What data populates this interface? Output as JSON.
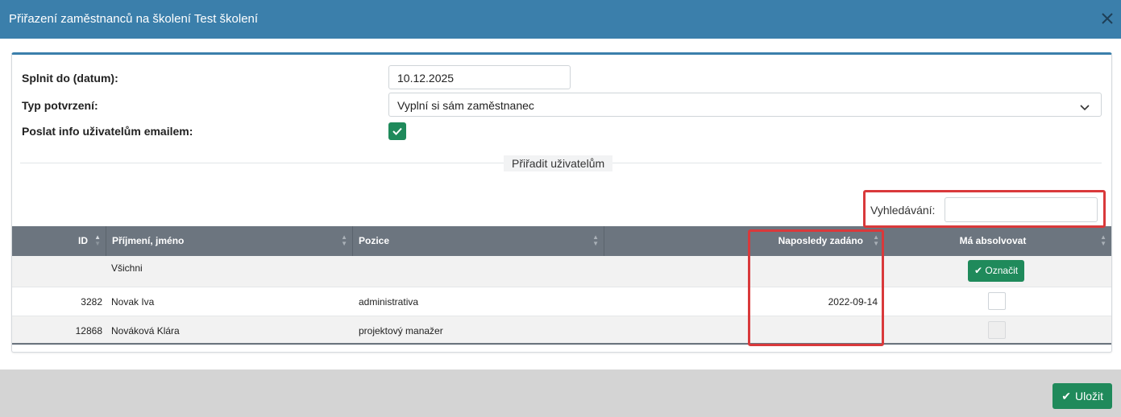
{
  "dialog": {
    "title": "Přiřazení zaměstnanců na školení Test školení"
  },
  "form": {
    "deadline_label": "Splnit do (datum):",
    "deadline_value": "10.12.2025",
    "confirm_type_label": "Typ potvrzení:",
    "confirm_type_value": "Vyplní si sám zaměstnanec",
    "email_label": "Poslat info uživatelům emailem:",
    "email_checked": true
  },
  "section": {
    "legend": "Přiřadit uživatelům"
  },
  "search": {
    "label": "Vyhledávání:",
    "value": ""
  },
  "table": {
    "columns": [
      "ID",
      "Příjmení, jméno",
      "Pozice",
      "Naposledy zadáno",
      "Má absolvovat"
    ],
    "all_row": {
      "label": "Všichni",
      "button": "Označit"
    },
    "rows": [
      {
        "id": "3282",
        "name": "Novak Iva",
        "position": "administrativa",
        "last_assigned": "2022-09-14",
        "checked": false,
        "disabled": false
      },
      {
        "id": "12868",
        "name": "Nováková Klára",
        "position": "projektový manažer",
        "last_assigned": "",
        "checked": false,
        "disabled": true
      }
    ]
  },
  "footer": {
    "save_label": "Uložit"
  },
  "colors": {
    "header": "#3b7fab",
    "accent": "#1f8a5b",
    "highlight": "#d9393b",
    "table_header": "#6c757f"
  }
}
